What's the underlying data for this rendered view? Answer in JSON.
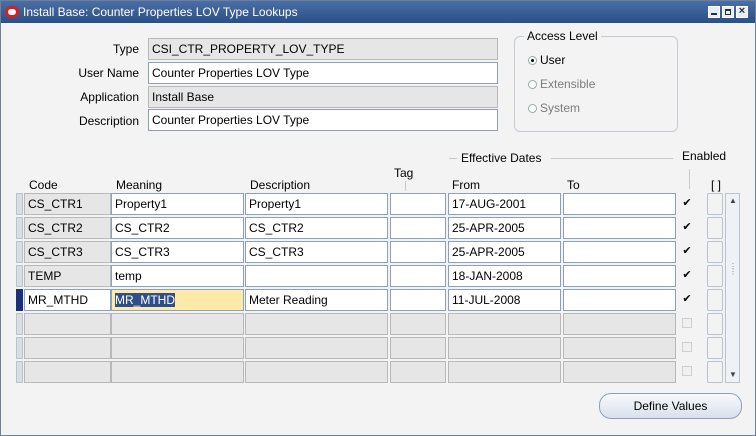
{
  "window": {
    "title": "Install Base: Counter Properties LOV Type Lookups"
  },
  "header": {
    "type_label": "Type",
    "type_value": "CSI_CTR_PROPERTY_LOV_TYPE",
    "username_label": "User Name",
    "username_value": "Counter Properties LOV Type",
    "application_label": "Application",
    "application_value": "Install Base",
    "description_label": "Description",
    "description_value": "Counter Properties LOV Type"
  },
  "access_level": {
    "title": "Access Level",
    "options": [
      {
        "label": "User",
        "selected": true
      },
      {
        "label": "Extensible",
        "selected": false
      },
      {
        "label": "System",
        "selected": false
      }
    ]
  },
  "table": {
    "effective_dates_label": "Effective Dates",
    "enabled_label": "Enabled",
    "bracket_label": "[ ]",
    "columns": {
      "code": "Code",
      "meaning": "Meaning",
      "description": "Description",
      "tag": "Tag",
      "from": "From",
      "to": "To"
    },
    "rows": [
      {
        "code": "CS_CTR1",
        "meaning": "Property1",
        "description": "Property1",
        "tag": "",
        "from": "17-AUG-2001",
        "to": "",
        "enabled": true
      },
      {
        "code": "CS_CTR2",
        "meaning": "CS_CTR2",
        "description": "CS_CTR2",
        "tag": "",
        "from": "25-APR-2005",
        "to": "",
        "enabled": true
      },
      {
        "code": "CS_CTR3",
        "meaning": "CS_CTR3",
        "description": "CS_CTR3",
        "tag": "",
        "from": "25-APR-2005",
        "to": "",
        "enabled": true
      },
      {
        "code": "TEMP",
        "meaning": "temp",
        "description": "",
        "tag": "",
        "from": "18-JAN-2008",
        "to": "",
        "enabled": true
      },
      {
        "code": "MR_MTHD",
        "meaning": "MR_MTHD",
        "description": "Meter Reading",
        "tag": "",
        "from": "11-JUL-2008",
        "to": "",
        "enabled": true
      },
      {
        "code": "",
        "meaning": "",
        "description": "",
        "tag": "",
        "from": "",
        "to": "",
        "enabled": false
      },
      {
        "code": "",
        "meaning": "",
        "description": "",
        "tag": "",
        "from": "",
        "to": "",
        "enabled": false
      },
      {
        "code": "",
        "meaning": "",
        "description": "",
        "tag": "",
        "from": "",
        "to": "",
        "enabled": false
      }
    ]
  },
  "buttons": {
    "define_values": "Define Values"
  }
}
